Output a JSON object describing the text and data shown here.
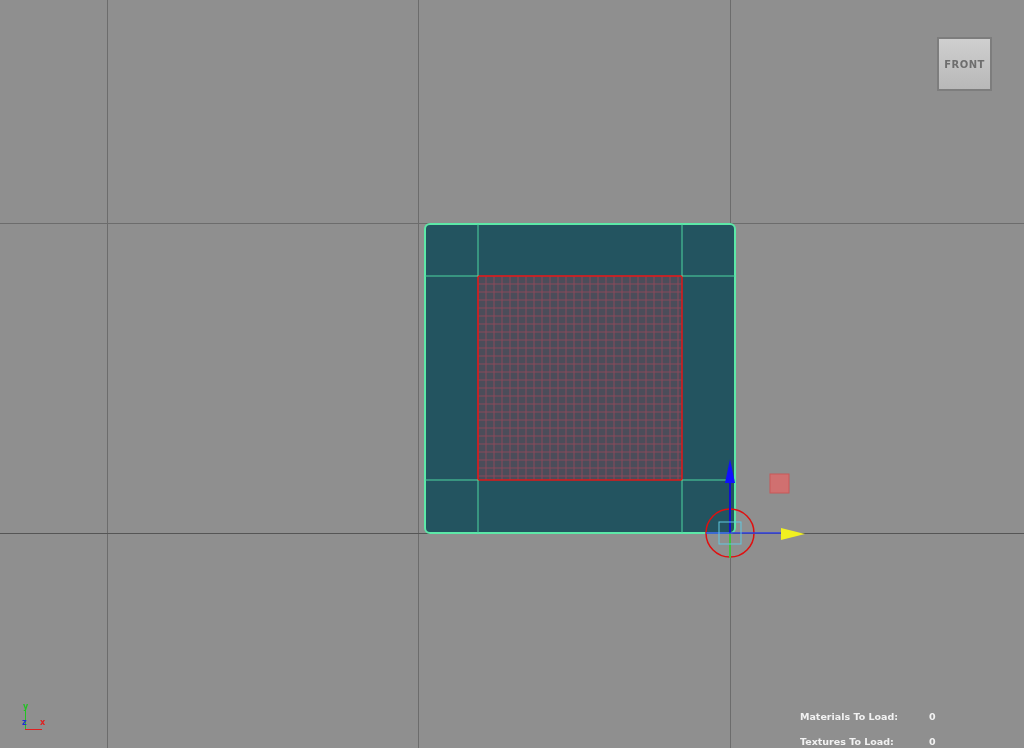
{
  "view_cube": {
    "label": "FRONT"
  },
  "axis_triad": {
    "labels": [
      "y",
      "z",
      "x"
    ]
  },
  "stats": [
    {
      "label": "Materials To Load:",
      "value": "0"
    },
    {
      "label": "Textures To Load:",
      "value": "0"
    }
  ]
}
